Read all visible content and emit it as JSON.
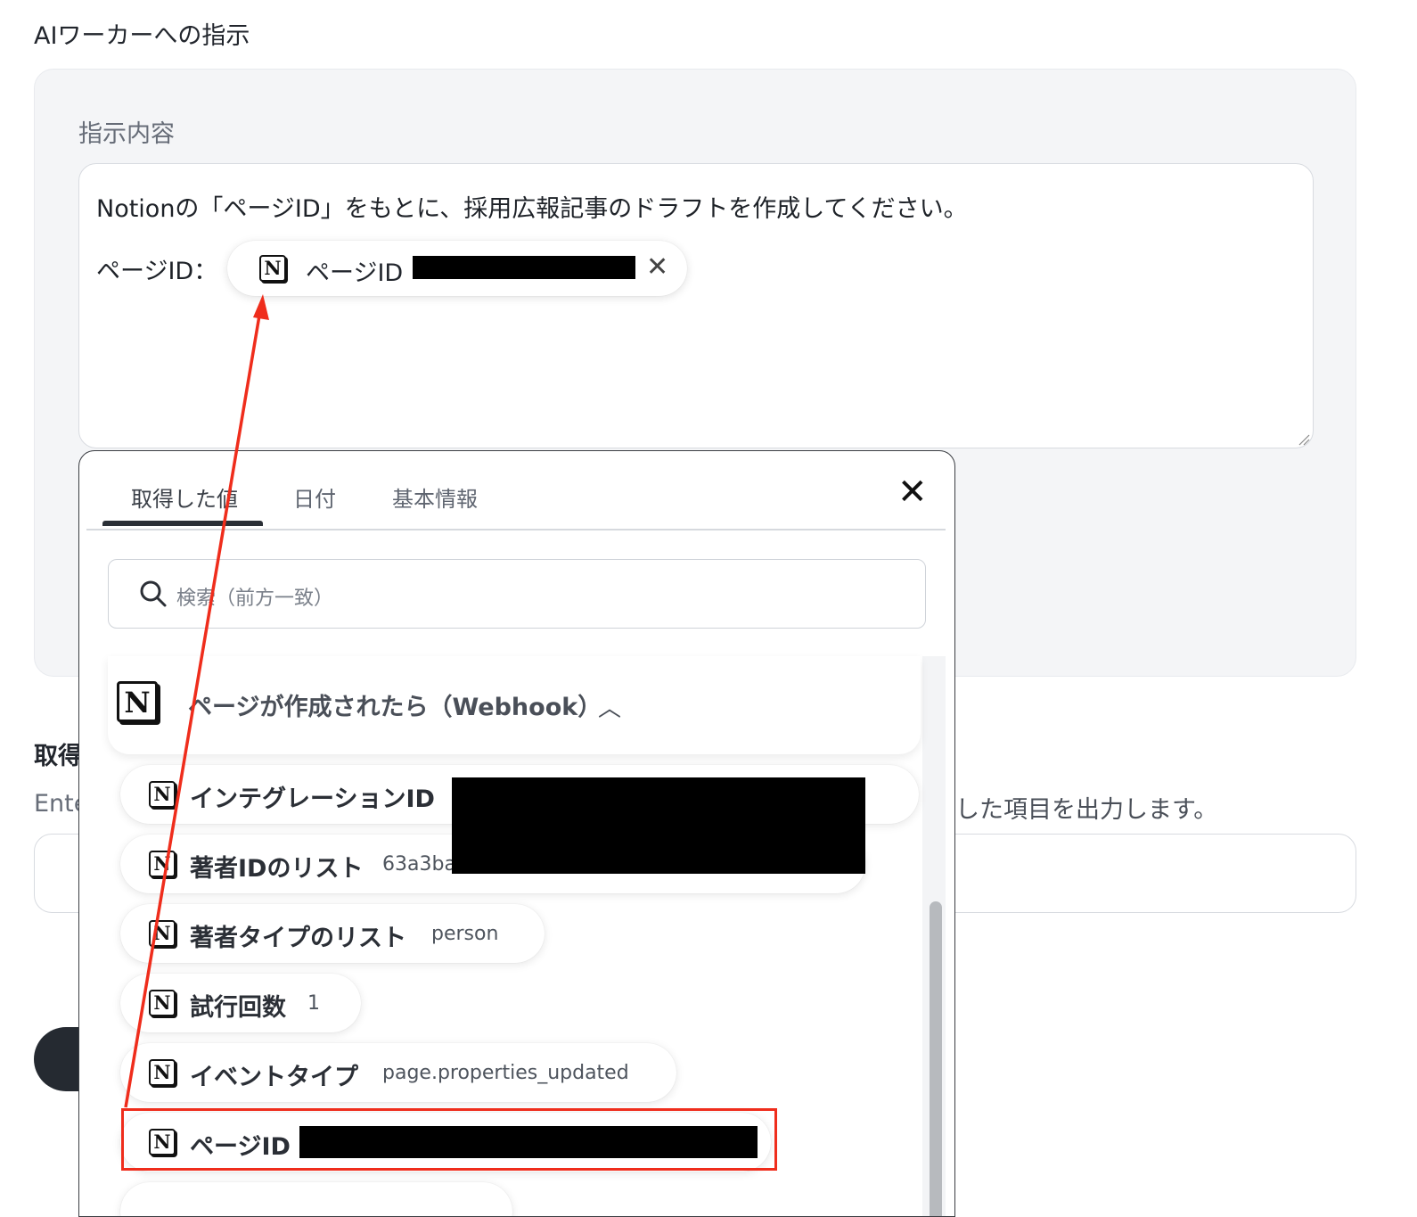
{
  "section_title": "AIワーカーへの指示",
  "instruction": {
    "label": "指示内容",
    "text": "Notionの「ページID」をもとに、採用広報記事のドラフトを作成してください。",
    "page_id_label": "ページID：",
    "chip": {
      "icon": "notion-icon",
      "label": "ページID"
    }
  },
  "section2": {
    "title_partial": "取得",
    "desc_partial": "Ente",
    "desc_right": "した項目を出力します。"
  },
  "popup": {
    "tabs": [
      "取得した値",
      "日付",
      "基本情報"
    ],
    "active_tab": 0,
    "search_placeholder": "検索（前方一致）",
    "group": {
      "icon": "notion-icon",
      "title": "ページが作成されたら（Webhook）"
    },
    "items": [
      {
        "label": "インテグレーションID",
        "value": ""
      },
      {
        "label": "著者IDのリスト",
        "value": "63a3ba"
      },
      {
        "label": "著者タイプのリスト",
        "value": "person"
      },
      {
        "label": "試行回数",
        "value": "1"
      },
      {
        "label": "イベントタイプ",
        "value": "page.properties_updated"
      },
      {
        "label": "ページID",
        "value": ""
      }
    ]
  },
  "colors": {
    "highlight": "#ef2d1c",
    "accent_dark": "#2a2f36"
  }
}
